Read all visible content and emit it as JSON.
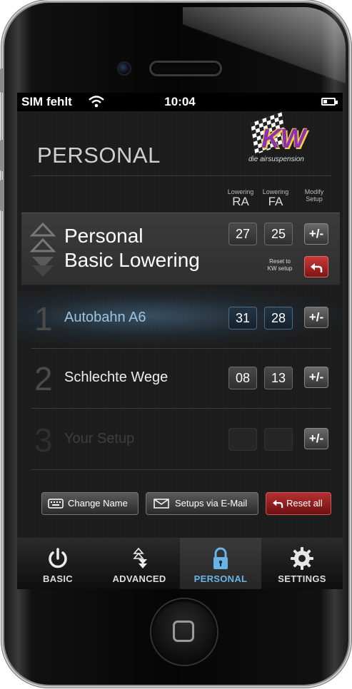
{
  "statusbar": {
    "carrier": "SIM fehlt",
    "time": "10:04"
  },
  "page": {
    "title": "PERSONAL"
  },
  "logo": {
    "text": "KW",
    "tagline": "die airsuspension"
  },
  "columns": {
    "ra": {
      "small": "Lowering",
      "big": "RA"
    },
    "fa": {
      "small": "Lowering",
      "big": "FA"
    },
    "modify": {
      "line1": "Modify",
      "line2": "Setup"
    }
  },
  "basic": {
    "title_line1": "Personal",
    "title_line2": "Basic Lowering",
    "ra": "27",
    "fa": "25",
    "modify_label": "+/-",
    "reset_line1": "Reset to",
    "reset_line2": "KW setup",
    "reset_icon": "undo-arrow-icon"
  },
  "setups": [
    {
      "num": "1",
      "name": "Autobahn A6",
      "ra": "31",
      "fa": "28",
      "modify_label": "+/-"
    },
    {
      "num": "2",
      "name": "Schlechte Wege",
      "ra": "08",
      "fa": "13",
      "modify_label": "+/-"
    },
    {
      "num": "3",
      "name": "Your Setup",
      "ra": "",
      "fa": "",
      "modify_label": "+/-"
    }
  ],
  "actions": {
    "change_name": "Change Name",
    "email": "Setups via E-Mail",
    "reset_all": "Reset all"
  },
  "tabs": [
    {
      "label": "BASIC",
      "icon": "power-icon"
    },
    {
      "label": "ADVANCED",
      "icon": "arrows-icon"
    },
    {
      "label": "PERSONAL",
      "icon": "lock-icon",
      "active": true
    },
    {
      "label": "SETTINGS",
      "icon": "gear-icon"
    }
  ],
  "colors": {
    "accent_blue": "#69b4e6",
    "reset_red": "#b53131",
    "logo_purple": "#8e2fb5",
    "logo_yellow": "#f1d23a"
  }
}
